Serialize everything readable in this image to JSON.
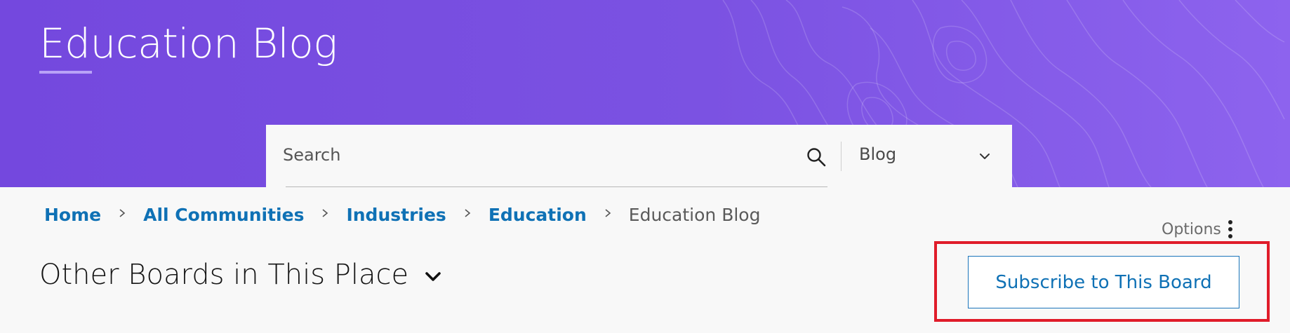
{
  "header": {
    "title": "Education Blog",
    "background_color": "#7b52e2",
    "accent_underline_color": "#b9a2f7"
  },
  "search": {
    "placeholder": "Search",
    "value": "",
    "scope_selected": "Blog",
    "icons": {
      "search": "search-icon",
      "dropdown": "chevron-down-icon"
    }
  },
  "breadcrumb": {
    "links": [
      "Home",
      "All Communities",
      "Industries",
      "Education"
    ],
    "current": "Education Blog",
    "link_color": "#0f71b5"
  },
  "options": {
    "label": "Options",
    "icon": "kebab-menu-icon"
  },
  "boards": {
    "label": "Other Boards in This Place",
    "icon": "chevron-down-icon"
  },
  "subscribe": {
    "label": "Subscribe to This Board",
    "highlight_color": "#e01c2a"
  }
}
